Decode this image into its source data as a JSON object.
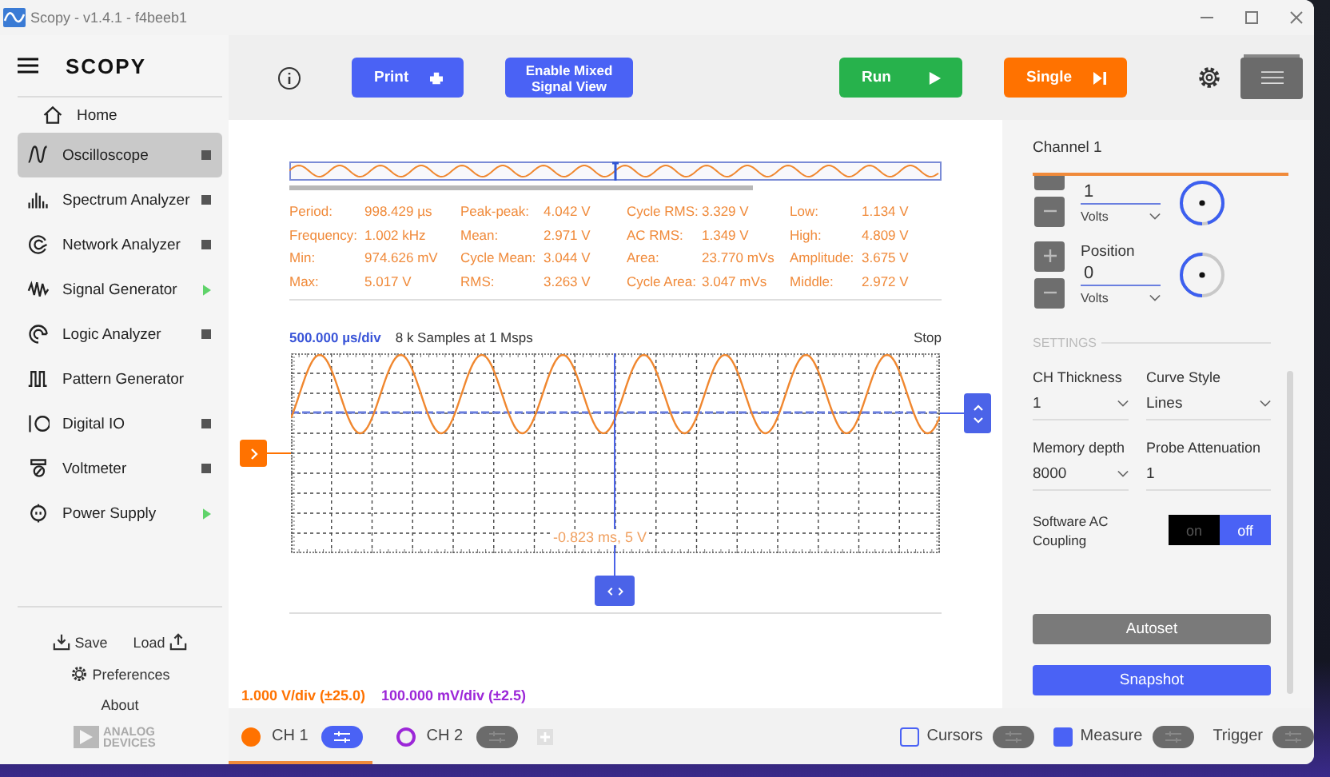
{
  "window": {
    "title": "Scopy - v1.4.1 - f4beeb1"
  },
  "sidebar": {
    "logo": "SCOPY",
    "items": [
      {
        "label": "Home",
        "kind": "home",
        "selected": false
      },
      {
        "label": "Oscilloscope",
        "kind": "oscilloscope",
        "selected": true,
        "running": true
      },
      {
        "label": "Spectrum Analyzer",
        "kind": "spectrum",
        "selected": false,
        "running": true
      },
      {
        "label": "Network Analyzer",
        "kind": "network",
        "selected": false,
        "running": true
      },
      {
        "label": "Signal Generator",
        "kind": "signal",
        "selected": false,
        "running": false
      },
      {
        "label": "Logic Analyzer",
        "kind": "logic",
        "selected": false,
        "running": true
      },
      {
        "label": "Pattern Generator",
        "kind": "pattern",
        "selected": false
      },
      {
        "label": "Digital IO",
        "kind": "digital",
        "selected": false,
        "running": true
      },
      {
        "label": "Voltmeter",
        "kind": "voltmeter",
        "selected": false,
        "running": true
      },
      {
        "label": "Power Supply",
        "kind": "power",
        "selected": false,
        "running": false
      }
    ],
    "save": "Save",
    "load": "Load",
    "preferences": "Preferences",
    "about": "About",
    "brand": "ANALOG DEVICES"
  },
  "toolbar": {
    "buttons": [
      {
        "label": "Print",
        "kind": "print"
      },
      {
        "label": "Enable Mixed Signal View",
        "kind": "mixed"
      },
      {
        "label": "Run",
        "kind": "run"
      },
      {
        "label": "Single",
        "kind": "single"
      }
    ]
  },
  "measurements": [
    [
      {
        "label": "Period:",
        "value": "998.429 µs"
      },
      {
        "label": "Frequency:",
        "value": "1.002 kHz"
      },
      {
        "label": "Min:",
        "value": "974.626 mV"
      },
      {
        "label": "Max:",
        "value": "5.017 V"
      }
    ],
    [
      {
        "label": "Peak-peak:",
        "value": "4.042 V"
      },
      {
        "label": "Mean:",
        "value": "2.971 V"
      },
      {
        "label": "Cycle Mean:",
        "value": "3.044 V"
      },
      {
        "label": "RMS:",
        "value": "3.263 V"
      }
    ],
    [
      {
        "label": "Cycle RMS:",
        "value": "3.329 V"
      },
      {
        "label": "AC RMS:",
        "value": "1.349 V"
      },
      {
        "label": "Area:",
        "value": "23.770 mVs"
      },
      {
        "label": "Cycle Area:",
        "value": "3.047 mVs"
      }
    ],
    [
      {
        "label": "Low:",
        "value": "1.134 V"
      },
      {
        "label": "High:",
        "value": "4.809 V"
      },
      {
        "label": "Amplitude:",
        "value": "3.675 V"
      },
      {
        "label": "Middle:",
        "value": "2.972 V"
      }
    ]
  ],
  "plot": {
    "time_base": "500.000 µs/div",
    "samples": "8 k Samples at 1 Msps",
    "status": "Stop",
    "cursor_readout": "-0.823 ms, 5 V"
  },
  "scales": [
    {
      "text": "1.000 V/div (±25.0)",
      "color": "#ff7200"
    },
    {
      "text": "100.000 mV/div (±2.5)",
      "color": "#9c27d8"
    }
  ],
  "channels": [
    {
      "label": "CH 1",
      "color": "#ff7200",
      "enabled": true,
      "selected": true,
      "menu_open": true
    },
    {
      "label": "CH 2",
      "color": "#9c27d8",
      "enabled": false,
      "selected": false,
      "menu_open": false
    }
  ],
  "bottom_toggles": [
    {
      "label": "Cursors",
      "kind": "checkbox",
      "checked": false,
      "menu_open": false
    },
    {
      "label": "Measure",
      "kind": "checkbox",
      "checked": true,
      "menu_open": false
    },
    {
      "label": "Trigger",
      "kind": "plain",
      "menu_open": false
    }
  ],
  "channel_panel": {
    "title": "Channel 1",
    "spinners": [
      {
        "value": "1",
        "unit": "Volts",
        "level": 0.95
      },
      {
        "label": "Position",
        "value": "0",
        "unit": "Volts",
        "level": 0.5
      }
    ],
    "settings_heading": "SETTINGS",
    "fields": [
      {
        "label": "CH Thickness",
        "value": "1",
        "kind": "dropdown"
      },
      {
        "label": "Curve Style",
        "value": "Lines",
        "kind": "dropdown"
      },
      {
        "label": "Memory depth",
        "value": "8000",
        "kind": "dropdown"
      },
      {
        "label": "Probe Attenuation",
        "value": "1",
        "kind": "input"
      }
    ],
    "ac_coupling": {
      "label": "Software AC Coupling",
      "options": [
        {
          "label": "on",
          "selected": false
        },
        {
          "label": "off",
          "selected": true
        }
      ]
    },
    "buttons": [
      {
        "label": "Autoset",
        "kind": "secondary"
      },
      {
        "label": "Snapshot",
        "kind": "primary"
      }
    ]
  }
}
